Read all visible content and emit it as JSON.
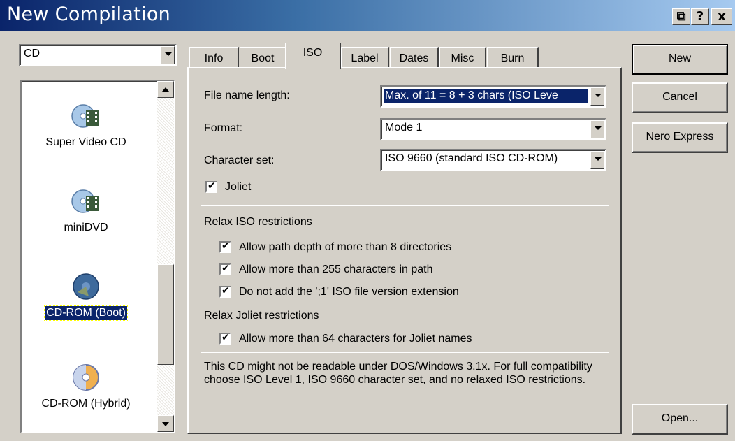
{
  "window": {
    "title": "New Compilation",
    "title_buttons": [
      "⧉",
      "?",
      "x"
    ]
  },
  "media_select": {
    "value": "CD"
  },
  "compilation_types": [
    {
      "label": "Super Video CD",
      "icon": "video-disc-icon",
      "selected": false
    },
    {
      "label": "miniDVD",
      "icon": "video-disc-icon",
      "selected": false
    },
    {
      "label": "CD-ROM (Boot)",
      "icon": "boot-disc-icon",
      "selected": true
    },
    {
      "label": "CD-ROM (Hybrid)",
      "icon": "hybrid-disc-icon",
      "selected": false
    }
  ],
  "tabs": [
    "Info",
    "Boot",
    "ISO",
    "Label",
    "Dates",
    "Misc",
    "Burn"
  ],
  "active_tab": "ISO",
  "iso": {
    "file_name_length_label": "File name length:",
    "file_name_length_value": "Max. of 11 = 8 + 3 chars (ISO Leve",
    "format_label": "Format:",
    "format_value": "Mode 1",
    "charset_label": "Character set:",
    "charset_value": "ISO 9660 (standard ISO CD-ROM)",
    "joliet_label": "Joliet",
    "joliet_checked": true,
    "relax_iso_heading": "Relax ISO restrictions",
    "relax_iso_options": [
      "Allow path depth of more than 8 directories",
      "Allow more than 255 characters in path",
      "Do not add the ';1' ISO file version extension"
    ],
    "relax_joliet_heading": "Relax Joliet restrictions",
    "relax_joliet_option": "Allow more than 64 characters for Joliet names",
    "note": "This CD might not be readable under DOS/Windows 3.1x. For full compatibility choose ISO Level 1, ISO 9660 character set, and no relaxed ISO restrictions."
  },
  "buttons": {
    "new": "New",
    "cancel": "Cancel",
    "nero_express": "Nero Express",
    "open": "Open..."
  },
  "colors": {
    "face": "#d4d0c8",
    "title_start": "#0a246a",
    "title_end": "#a6caf0",
    "selection": "#0a246a"
  }
}
